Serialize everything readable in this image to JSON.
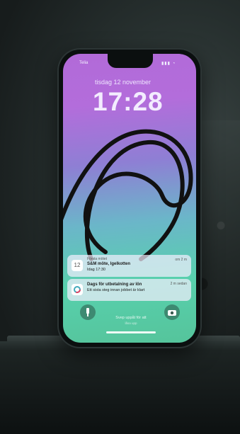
{
  "status_bar": {
    "carrier": "Telia",
    "signal_indicators": "▮▮▮ ◔"
  },
  "lock_screen": {
    "date": "tisdag 12 november",
    "time": "17:28"
  },
  "notifications": [
    {
      "icon": "calendar-icon",
      "icon_text": "12",
      "app": "Första mötet",
      "title": "S&M möte, Igelkotten",
      "body": "Idag 17:30",
      "time": "om 2 m"
    },
    {
      "icon": "reminder-icon",
      "icon_text": "",
      "title": "Dags för utbetalning av lön",
      "body": "Ett sista steg innan jobbet är klart",
      "time": "2 m sedan"
    }
  ],
  "bottom_bar": {
    "flashlight_icon": "flashlight-icon",
    "camera_icon": "camera-icon",
    "swipe_text": "Svep uppåt för att",
    "swipe_subtext": "låsa upp"
  }
}
